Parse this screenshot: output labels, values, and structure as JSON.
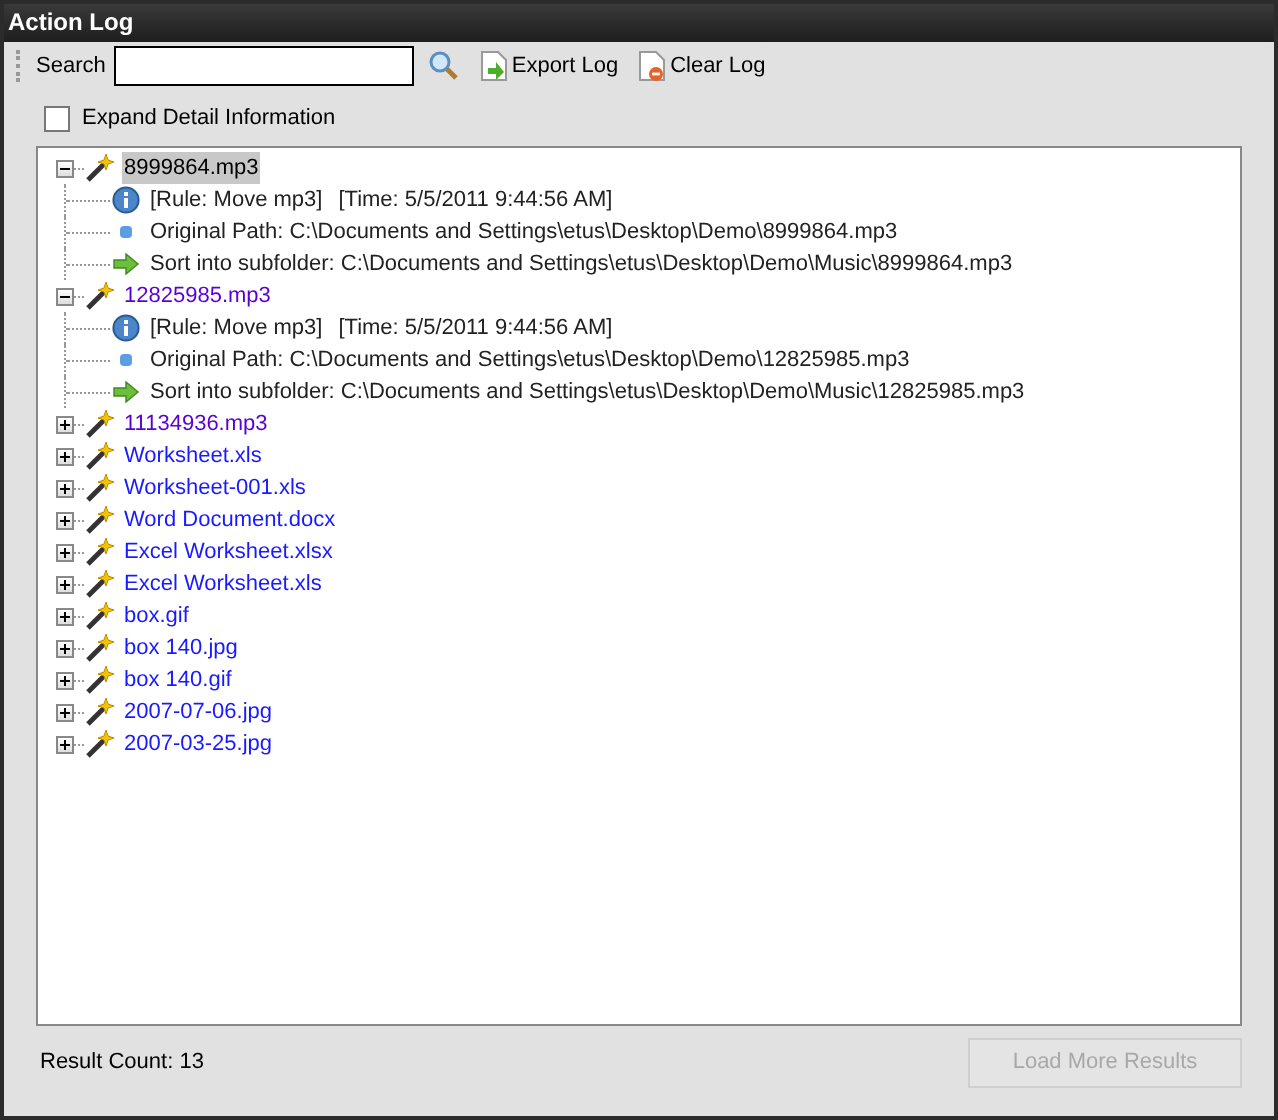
{
  "window": {
    "title": "Action Log"
  },
  "toolbar": {
    "search_label": "Search",
    "export": "Export Log",
    "clear": "Clear Log"
  },
  "expand_detail": {
    "label": "Expand Detail Information",
    "checked": false
  },
  "tree": [
    {
      "label": "8999864.mp3",
      "expanded": true,
      "selected": true,
      "color": "#000000",
      "children": [
        {
          "kind": "info",
          "texts": [
            "[Rule: Move mp3]",
            "[Time: 5/5/2011 9:44:56 AM]"
          ]
        },
        {
          "kind": "path",
          "texts": [
            "Original Path: C:\\Documents and Settings\\etus\\Desktop\\Demo\\8999864.mp3"
          ]
        },
        {
          "kind": "sort",
          "texts": [
            "Sort into subfolder: C:\\Documents and Settings\\etus\\Desktop\\Demo\\Music\\8999864.mp3"
          ]
        }
      ]
    },
    {
      "label": "12825985.mp3",
      "expanded": true,
      "selected": false,
      "color": "#5a00d6",
      "children": [
        {
          "kind": "info",
          "texts": [
            "[Rule: Move mp3]",
            "[Time: 5/5/2011 9:44:56 AM]"
          ]
        },
        {
          "kind": "path",
          "texts": [
            "Original Path: C:\\Documents and Settings\\etus\\Desktop\\Demo\\12825985.mp3"
          ]
        },
        {
          "kind": "sort",
          "texts": [
            "Sort into subfolder: C:\\Documents and Settings\\etus\\Desktop\\Demo\\Music\\12825985.mp3"
          ]
        }
      ]
    },
    {
      "label": "11134936.mp3",
      "expanded": false,
      "selected": false,
      "color": "#5a00d6"
    },
    {
      "label": "Worksheet.xls",
      "expanded": false,
      "selected": false,
      "color": "#1a1aff"
    },
    {
      "label": "Worksheet-001.xls",
      "expanded": false,
      "selected": false,
      "color": "#1a1aff"
    },
    {
      "label": "Word Document.docx",
      "expanded": false,
      "selected": false,
      "color": "#1a1aff"
    },
    {
      "label": "Excel Worksheet.xlsx",
      "expanded": false,
      "selected": false,
      "color": "#1a1aff"
    },
    {
      "label": "Excel Worksheet.xls",
      "expanded": false,
      "selected": false,
      "color": "#1a1aff"
    },
    {
      "label": "box.gif",
      "expanded": false,
      "selected": false,
      "color": "#1a1aff"
    },
    {
      "label": "box 140.jpg",
      "expanded": false,
      "selected": false,
      "color": "#1a1aff"
    },
    {
      "label": "box 140.gif",
      "expanded": false,
      "selected": false,
      "color": "#1a1aff"
    },
    {
      "label": "2007-07-06.jpg",
      "expanded": false,
      "selected": false,
      "color": "#1a1aff"
    },
    {
      "label": "2007-03-25.jpg",
      "expanded": false,
      "selected": false,
      "color": "#1a1aff"
    }
  ],
  "footer": {
    "result_count": "Result Count: 13",
    "load_more": {
      "label": "Load More Results",
      "disabled": true
    }
  }
}
